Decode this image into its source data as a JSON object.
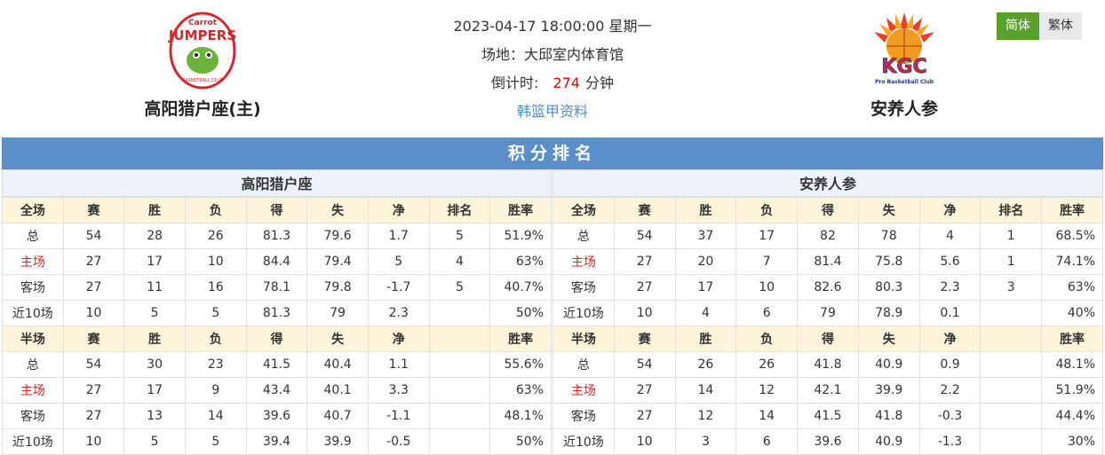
{
  "home": {
    "name": "高阳猎户座(主)",
    "logo_text_top": "Carrot",
    "logo_text_main": "JUMPERS",
    "logo_text_bottom": "BASKETBALL CLUB"
  },
  "away": {
    "name": "安养人参",
    "logo_text_main": "KGC",
    "logo_text_bottom": "Pro Basketball Club"
  },
  "match": {
    "datetime": "2023-04-17 18:00:00 星期一",
    "venue": "场地：大邱室内体育馆",
    "countdown_label": "倒计时:",
    "countdown_value": "274",
    "countdown_unit": "分钟",
    "league_link": "韩篮甲资料"
  },
  "lang": {
    "simplified": "简体",
    "traditional": "繁体"
  },
  "standings": {
    "title": "积分排名",
    "full_headers": [
      "全场",
      "赛",
      "胜",
      "负",
      "得",
      "失",
      "净",
      "排名",
      "胜率"
    ],
    "half_headers": [
      "半场",
      "赛",
      "胜",
      "负",
      "得",
      "失",
      "净",
      "",
      "胜率"
    ],
    "left": {
      "team": "高阳猎户座",
      "full": [
        [
          "总",
          "54",
          "28",
          "26",
          "81.3",
          "79.6",
          "1.7",
          "5",
          "51.9%"
        ],
        [
          "主场",
          "27",
          "17",
          "10",
          "84.4",
          "79.4",
          "5",
          "4",
          "63%"
        ],
        [
          "客场",
          "27",
          "11",
          "16",
          "78.1",
          "79.8",
          "-1.7",
          "5",
          "40.7%"
        ],
        [
          "近10场",
          "10",
          "5",
          "5",
          "81.3",
          "79",
          "2.3",
          "",
          "50%"
        ]
      ],
      "half": [
        [
          "总",
          "54",
          "30",
          "23",
          "41.5",
          "40.4",
          "1.1",
          "",
          "55.6%"
        ],
        [
          "主场",
          "27",
          "17",
          "9",
          "43.4",
          "40.1",
          "3.3",
          "",
          "63%"
        ],
        [
          "客场",
          "27",
          "13",
          "14",
          "39.6",
          "40.7",
          "-1.1",
          "",
          "48.1%"
        ],
        [
          "近10场",
          "10",
          "5",
          "5",
          "39.4",
          "39.9",
          "-0.5",
          "",
          "50%"
        ]
      ]
    },
    "right": {
      "team": "安养人参",
      "full": [
        [
          "总",
          "54",
          "37",
          "17",
          "82",
          "78",
          "4",
          "1",
          "68.5%"
        ],
        [
          "主场",
          "27",
          "20",
          "7",
          "81.4",
          "75.8",
          "5.6",
          "1",
          "74.1%"
        ],
        [
          "客场",
          "27",
          "17",
          "10",
          "82.6",
          "80.3",
          "2.3",
          "3",
          "63%"
        ],
        [
          "近10场",
          "10",
          "4",
          "6",
          "79",
          "78.9",
          "0.1",
          "",
          "40%"
        ]
      ],
      "half": [
        [
          "总",
          "54",
          "26",
          "26",
          "41.8",
          "40.9",
          "0.9",
          "",
          "48.1%"
        ],
        [
          "主场",
          "27",
          "14",
          "12",
          "42.1",
          "39.9",
          "2.2",
          "",
          "51.9%"
        ],
        [
          "客场",
          "27",
          "12",
          "14",
          "41.5",
          "41.8",
          "-0.3",
          "",
          "44.4%"
        ],
        [
          "近10场",
          "10",
          "3",
          "6",
          "39.6",
          "40.9",
          "-1.3",
          "",
          "30%"
        ]
      ]
    }
  }
}
